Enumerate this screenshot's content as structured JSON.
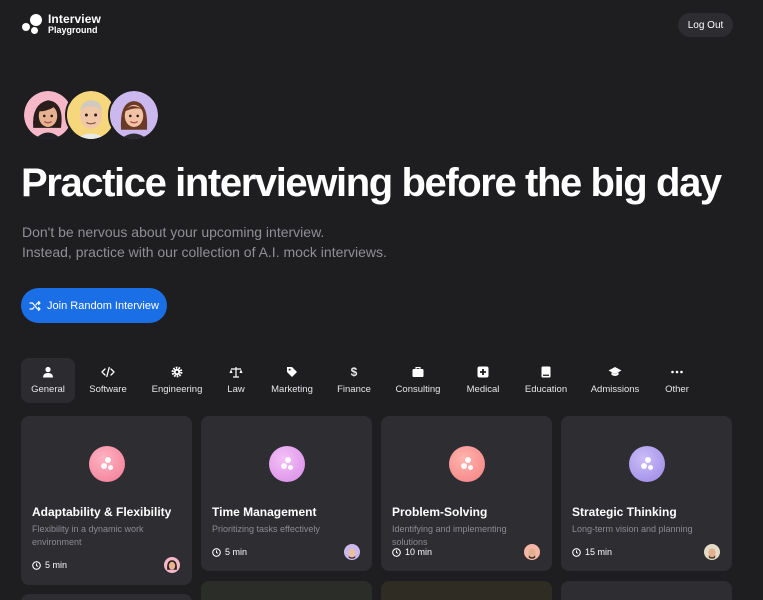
{
  "header": {
    "logo_line1": "Interview",
    "logo_line2": "Playground",
    "logout_label": "Log Out"
  },
  "hero": {
    "title": "Practice interviewing before the big day",
    "subtitle_line1": "Don't be nervous about your upcoming interview.",
    "subtitle_line2": "Instead, practice with our collection of A.I. mock interviews.",
    "cta_label": "Join Random Interview",
    "cta_icon": "shuffle-icon",
    "avatars": [
      {
        "name": "interviewer-avatar-woman-pink",
        "bg": "#f6b7c8"
      },
      {
        "name": "interviewer-avatar-man-yellow",
        "bg": "#f7d77c"
      },
      {
        "name": "interviewer-avatar-woman-purple",
        "bg": "#cbb8ef"
      }
    ]
  },
  "tabs": [
    {
      "label": "General",
      "icon": "person-icon",
      "active": true
    },
    {
      "label": "Software",
      "icon": "code-icon",
      "active": false
    },
    {
      "label": "Engineering",
      "icon": "gear-icon",
      "active": false
    },
    {
      "label": "Law",
      "icon": "scales-icon",
      "active": false
    },
    {
      "label": "Marketing",
      "icon": "tag-icon",
      "active": false
    },
    {
      "label": "Finance",
      "icon": "dollar-icon",
      "active": false
    },
    {
      "label": "Consulting",
      "icon": "briefcase-icon",
      "active": false
    },
    {
      "label": "Medical",
      "icon": "medical-cross-icon",
      "active": false
    },
    {
      "label": "Education",
      "icon": "book-icon",
      "active": false
    },
    {
      "label": "Admissions",
      "icon": "graduation-cap-icon",
      "active": false
    },
    {
      "label": "Other",
      "icon": "ellipsis-icon",
      "active": false
    }
  ],
  "cards": [
    {
      "title": "Adaptability & Flexibility",
      "description": "Flexibility in a dynamic work environment",
      "duration": "5 min",
      "accent": "#f27a94"
    },
    {
      "title": "Time Management",
      "description": "Prioritizing tasks effectively",
      "duration": "5 min",
      "accent": "#d98ae6"
    },
    {
      "title": "Problem-Solving",
      "description": "Identifying and implementing solutions",
      "duration": "10 min",
      "accent": "#f47f80"
    },
    {
      "title": "Strategic Thinking",
      "description": "Long-term vision and planning",
      "duration": "15 min",
      "accent": "#9b86e6"
    }
  ],
  "colors": {
    "background": "#1e1e21",
    "card": "#2e2d32",
    "accent_blue": "#1b6fe6"
  }
}
